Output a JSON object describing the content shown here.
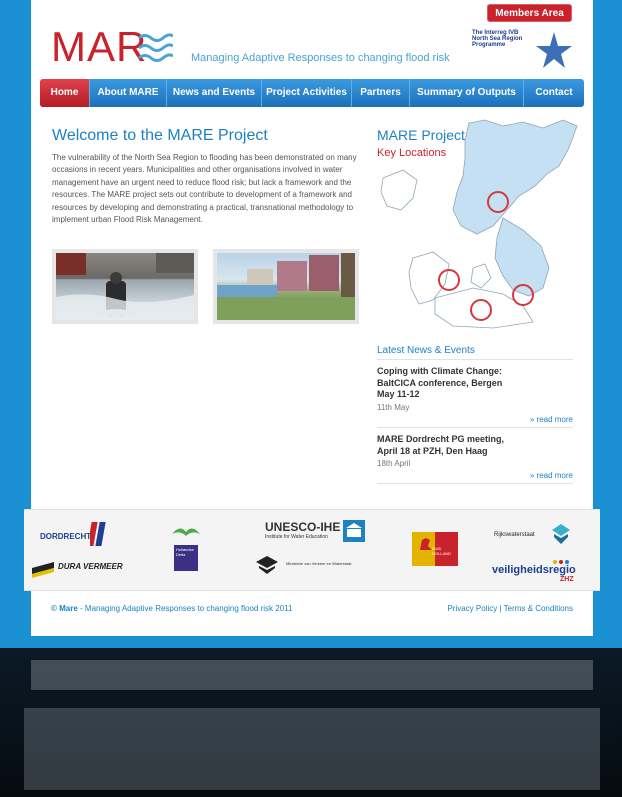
{
  "header": {
    "members_label": "Members Area",
    "logo_text": "MAR",
    "tagline": "Managing Adaptive Responses to changing flood risk",
    "interreg_line1": "The Interreg IVB",
    "interreg_line2": "North Sea Region",
    "interreg_line3": "Programme"
  },
  "nav": {
    "items": [
      {
        "label": "Home"
      },
      {
        "label": "About MARE"
      },
      {
        "label": "News and Events"
      },
      {
        "label": "Project Activities"
      },
      {
        "label": "Partners"
      },
      {
        "label": "Summary of Outputs"
      },
      {
        "label": "Contact"
      }
    ]
  },
  "main": {
    "title": "Welcome to the MARE Project",
    "text": "The vulnerability of the North Sea Region to flooding has been demonstrated on many occasions in recent years. Municipalities and other organisations involved in water management have an urgent need to reduce flood risk; but lack a framework and the resources. The MARE project sets out contribute to development of a framework and resources by developing and demonstrating a practical, transnational methodology to implement urban Flood Risk Management."
  },
  "sidebar": {
    "map_title": "MARE Project",
    "map_subtitle": "Key Locations",
    "news_title": "Latest News & Events",
    "news": [
      {
        "headline": "Coping with Climate Change: BaltCICA conference, Bergen May 11-12",
        "date": "11th May",
        "link": "» read more"
      },
      {
        "headline": "MARE Dordrecht PG meeting, April 18 at PZH, Den Haag",
        "date": "18th April",
        "link": "» read more"
      }
    ]
  },
  "partners": {
    "dordrecht": "DORDRECHT",
    "duravermeer": "DURA VERMEER",
    "unesco": "UNESCO-IHE",
    "unesco_sub": "Institute for Water Education",
    "ministry": "Ministerie van Verkeer en Waterstaat",
    "rijkswaterstaat": "Rijkswaterstaat",
    "veiligheidsregio": "veiligheidsregio",
    "zhz": "ZHZ",
    "hollandse_delta": "Hollandse Delta",
    "zuid_holland": "ZUID HOLLAND"
  },
  "footer": {
    "copyright_brand": "Mare",
    "copyright_rest": " - Managing Adaptive Responses to changing flood risk 2011",
    "privacy": "Privacy Policy",
    "separator": "|",
    "terms": "Terms & Conditions"
  },
  "colors": {
    "brand_red": "#c8232c",
    "brand_blue": "#1d82c4",
    "background": "#1a8fd1"
  }
}
